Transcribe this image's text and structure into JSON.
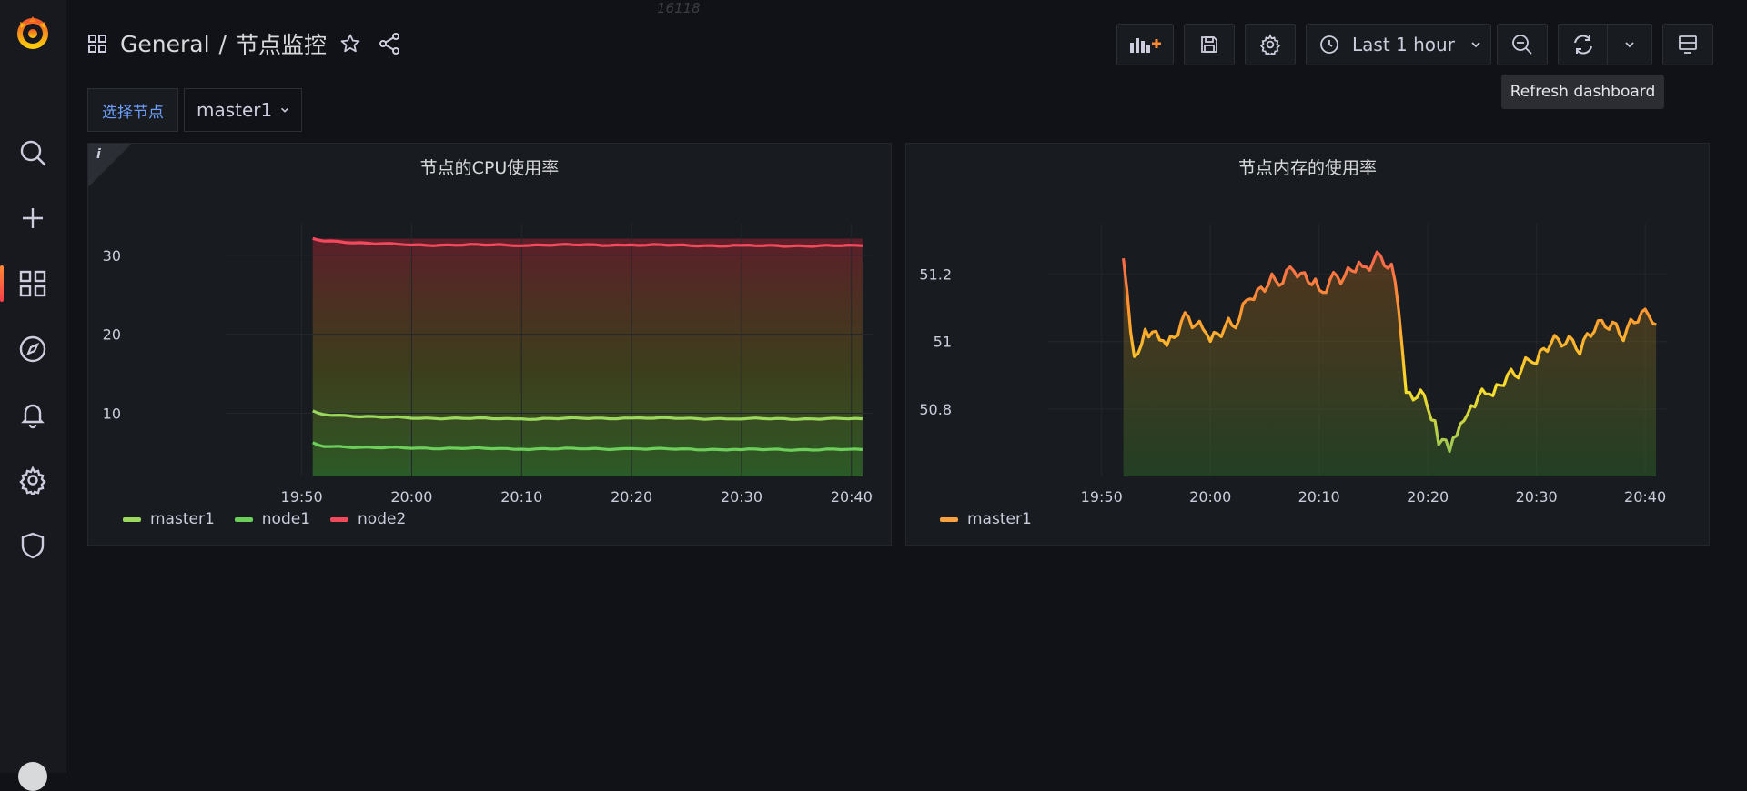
{
  "header": {
    "folder": "General",
    "separator": "/",
    "dashboard_title": "节点监控",
    "watermark": "16118"
  },
  "toolbar": {
    "time_range": "Last 1 hour",
    "refresh_tooltip": "Refresh dashboard"
  },
  "variables": {
    "label": "选择节点",
    "value": "master1"
  },
  "colors": {
    "background": "#111217",
    "panel": "#181b1f",
    "master1_cpu": "#9bd85e",
    "node1_cpu": "#6ccf5a",
    "node2_cpu": "#f2495c",
    "memory_master1": "#f9a03f",
    "accent_link": "#6e9fff"
  },
  "sidebar": {
    "icons": [
      "grafana-logo-icon",
      "search-icon",
      "plus-icon",
      "dashboards-icon",
      "explore-icon",
      "alerting-bell-icon",
      "settings-gear-icon",
      "shield-icon",
      "user-avatar"
    ]
  },
  "chart_data": [
    {
      "type": "line",
      "title": "节点的CPU使用率",
      "x_ticks": [
        "19:50",
        "20:00",
        "20:10",
        "20:20",
        "20:30",
        "20:40"
      ],
      "y_ticks": [
        10,
        20,
        30
      ],
      "ylim": [
        2,
        34
      ],
      "xlim": [
        "19:43",
        "20:42"
      ],
      "grid": true,
      "legend_placement": "bottom-left",
      "series": [
        {
          "name": "master1",
          "x": [
            "19:51",
            "19:52",
            "20:00",
            "20:10",
            "20:20",
            "20:30",
            "20:41"
          ],
          "values": [
            10.2,
            9.8,
            9.4,
            9.3,
            9.4,
            9.3,
            9.3
          ]
        },
        {
          "name": "node1",
          "x": [
            "19:51",
            "19:52",
            "20:00",
            "20:10",
            "20:20",
            "20:30",
            "20:41"
          ],
          "values": [
            6.2,
            5.8,
            5.6,
            5.5,
            5.5,
            5.4,
            5.4
          ]
        },
        {
          "name": "node2",
          "x": [
            "19:51",
            "19:52",
            "20:00",
            "20:10",
            "20:20",
            "20:30",
            "20:41"
          ],
          "values": [
            32.1,
            31.8,
            31.3,
            31.3,
            31.3,
            31.2,
            31.2
          ]
        }
      ]
    },
    {
      "type": "line",
      "title": "节点内存的使用率",
      "x_ticks": [
        "19:50",
        "20:00",
        "20:10",
        "20:20",
        "20:30",
        "20:40"
      ],
      "y_ticks": [
        "50.8",
        "51",
        "51.2"
      ],
      "ylim": [
        50.6,
        51.35
      ],
      "xlim": [
        "19:45",
        "20:42"
      ],
      "grid": true,
      "legend_placement": "bottom-left",
      "series": [
        {
          "name": "master1",
          "x": [
            "19:52",
            "19:53",
            "19:54",
            "19:56",
            "19:58",
            "20:00",
            "20:02",
            "20:04",
            "20:06",
            "20:08",
            "20:10",
            "20:12",
            "20:14",
            "20:16",
            "20:17",
            "20:18",
            "20:20",
            "20:21",
            "20:22",
            "20:23",
            "20:24",
            "20:26",
            "20:28",
            "20:30",
            "20:32",
            "20:34",
            "20:36",
            "20:38",
            "20:40",
            "20:41"
          ],
          "values": [
            51.25,
            50.95,
            51.05,
            51.0,
            51.08,
            51.02,
            51.05,
            51.15,
            51.18,
            51.22,
            51.15,
            51.2,
            51.22,
            51.25,
            51.2,
            50.85,
            50.82,
            50.72,
            50.68,
            50.75,
            50.82,
            50.85,
            50.9,
            50.95,
            51.0,
            50.98,
            51.05,
            51.02,
            51.08,
            51.05
          ]
        }
      ]
    }
  ]
}
